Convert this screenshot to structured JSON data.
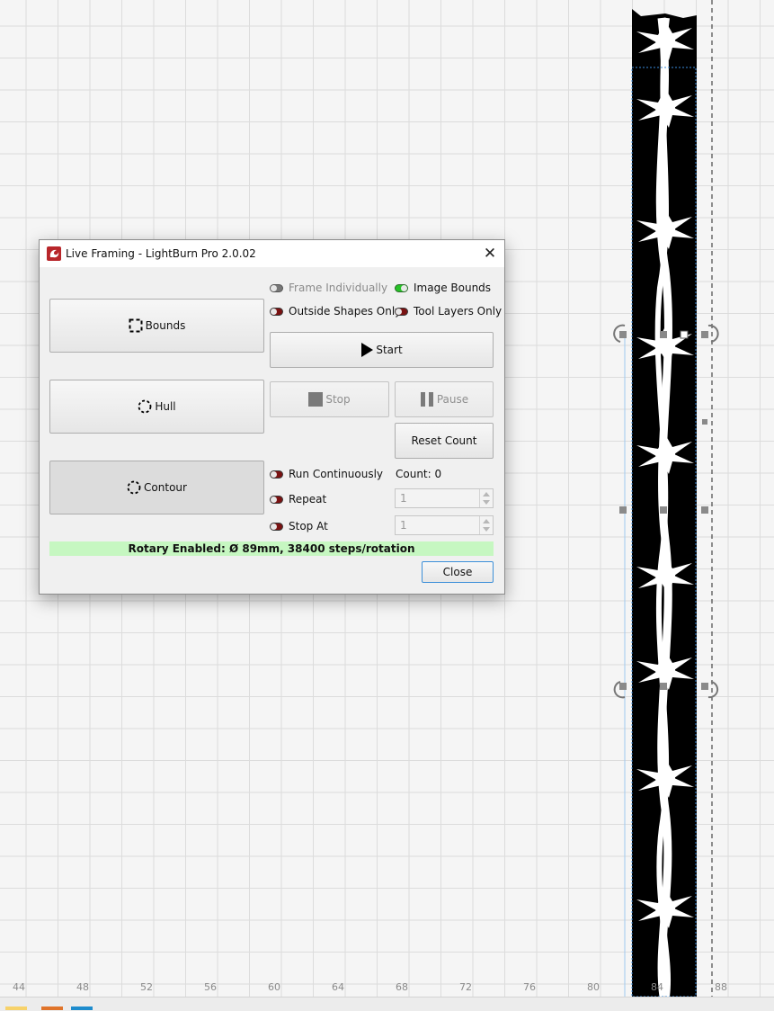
{
  "dialog": {
    "title": "Live Framing - LightBurn Pro 2.0.02",
    "close_glyph": "✕",
    "buttons": {
      "bounds": "Bounds",
      "hull": "Hull",
      "contour": "Contour",
      "start": "Start",
      "stop": "Stop",
      "pause": "Pause",
      "reset_count": "Reset Count",
      "close": "Close"
    },
    "toggles": {
      "frame_individually": {
        "label": "Frame Individually",
        "state": "disabled"
      },
      "image_bounds": {
        "label": "Image Bounds",
        "state": "on"
      },
      "outside_shapes_only": {
        "label": "Outside Shapes Only",
        "state": "off"
      },
      "tool_layers_only": {
        "label": "Tool Layers Only",
        "state": "off"
      },
      "run_continuously": {
        "label": "Run Continuously",
        "state": "off"
      },
      "repeat": {
        "label": "Repeat",
        "state": "off"
      },
      "stop_at": {
        "label": "Stop At",
        "state": "off"
      }
    },
    "count_label": "Count: 0",
    "repeat_value": "1",
    "stop_at_value": "1",
    "rotary_status": "Rotary Enabled: Ø 89mm, 38400 steps/rotation",
    "rotary_bg": "#c6f7c1"
  },
  "ruler": {
    "labels": [
      "44",
      "48",
      "52",
      "56",
      "60",
      "64",
      "68",
      "72",
      "76",
      "80",
      "84",
      "88"
    ]
  },
  "palette": [
    "#f7d26a",
    "#e0742a",
    "#1e8ccd"
  ],
  "icons": {
    "app": "lightburn-logo-icon",
    "bounds": "dashed-square-icon",
    "hull": "dashed-circle-icon",
    "contour": "dashed-circle-icon",
    "start": "play-icon",
    "stop": "stop-square-icon",
    "pause": "pause-icon"
  }
}
